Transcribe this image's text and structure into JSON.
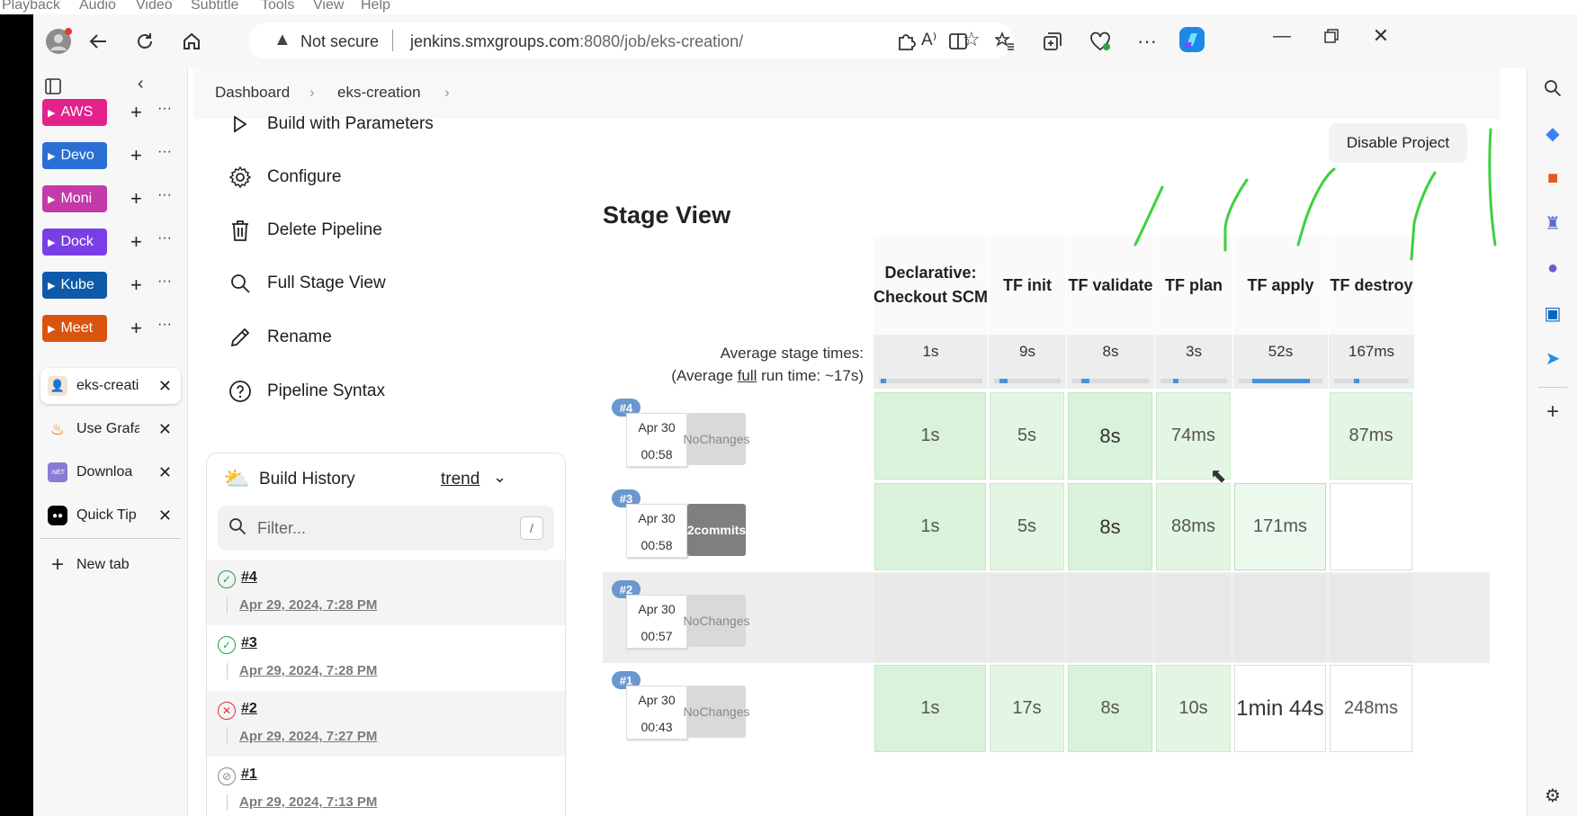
{
  "player_menu": [
    "Playback",
    "Audio",
    "Video",
    "Subtitle",
    "Tools",
    "View",
    "Help"
  ],
  "browser": {
    "security_label": "Not secure",
    "url_host": "jenkins.smxgroups.com",
    "url_rest": ":8080/job/eks-creation/",
    "new_tab_label": "New tab"
  },
  "tab_groups": [
    {
      "label": "AWS",
      "color": "#e3228c"
    },
    {
      "label": "Devo",
      "color": "#2b6fd4"
    },
    {
      "label": "Moni",
      "color": "#c43aa8"
    },
    {
      "label": "Dock",
      "color": "#7a3ee6"
    },
    {
      "label": "Kube",
      "color": "#0f5aa8"
    },
    {
      "label": "Meet",
      "color": "#d9540f"
    }
  ],
  "open_tabs": [
    {
      "label": "eks-creati",
      "icon": "jenkins-icon"
    },
    {
      "label": "Use Grafa",
      "icon": "grafana-icon"
    },
    {
      "label": "Downloa",
      "icon": "dotnet-icon"
    },
    {
      "label": "Quick Tip",
      "icon": "video-icon"
    }
  ],
  "breadcrumb": {
    "root": "Dashboard",
    "job": "eks-creation"
  },
  "side_menu": [
    {
      "label": "Build with Parameters",
      "icon": "play-icon"
    },
    {
      "label": "Configure",
      "icon": "gear-icon"
    },
    {
      "label": "Delete Pipeline",
      "icon": "trash-icon"
    },
    {
      "label": "Full Stage View",
      "icon": "search-icon"
    },
    {
      "label": "Rename",
      "icon": "pencil-icon"
    },
    {
      "label": "Pipeline Syntax",
      "icon": "help-icon"
    }
  ],
  "disable_button": "Disable Project",
  "stage_view": {
    "title": "Stage View",
    "avg_label": "Average stage times:",
    "avg_run_prefix": "(Average ",
    "avg_run_full": "full",
    "avg_run_suffix": " run time: ~17s)",
    "stages": [
      {
        "name": "Declarative: Checkout SCM",
        "avg": "1s",
        "bar_fill": 0.02
      },
      {
        "name": "TF init",
        "avg": "9s",
        "bar_fill": 0.12
      },
      {
        "name": "TF validate",
        "avg": "8s",
        "bar_fill": 0.1
      },
      {
        "name": "TF plan",
        "avg": "3s",
        "bar_fill": 0.04
      },
      {
        "name": "TF apply",
        "avg": "52s",
        "bar_fill": 0.68
      },
      {
        "name": "TF destroy",
        "avg": "167ms",
        "bar_fill": 0.01
      }
    ],
    "runs": [
      {
        "badge": "#4",
        "date": "Apr 30",
        "time": "00:58",
        "changes": "No Changes",
        "has_commits": false,
        "cells": [
          "1s",
          "5s",
          "8s",
          "74ms",
          "",
          "87ms"
        ]
      },
      {
        "badge": "#3",
        "date": "Apr 30",
        "time": "00:58",
        "changes": "2 commits",
        "has_commits": true,
        "cells": [
          "1s",
          "5s",
          "8s",
          "88ms",
          "171ms",
          ""
        ]
      },
      {
        "badge": "#2",
        "date": "Apr 30",
        "time": "00:57",
        "changes": "No Changes",
        "has_commits": false,
        "cells": [
          "",
          "",
          "",
          "",
          "",
          ""
        ]
      },
      {
        "badge": "#1",
        "date": "Apr 30",
        "time": "00:43",
        "changes": "No Changes",
        "has_commits": false,
        "cells": [
          "1s",
          "17s",
          "8s",
          "10s",
          "1min 44s",
          "248ms"
        ]
      }
    ]
  },
  "build_history": {
    "title": "Build History",
    "trend_label": "trend",
    "filter_placeholder": "Filter...",
    "filter_shortcut": "/",
    "builds": [
      {
        "num": "#4",
        "date": "Apr 29, 2024, 7:28 PM",
        "status": "success"
      },
      {
        "num": "#3",
        "date": "Apr 29, 2024, 7:28 PM",
        "status": "success"
      },
      {
        "num": "#2",
        "date": "Apr 29, 2024, 7:27 PM",
        "status": "failed"
      },
      {
        "num": "#1",
        "date": "Apr 29, 2024, 7:13 PM",
        "status": "aborted"
      }
    ]
  }
}
